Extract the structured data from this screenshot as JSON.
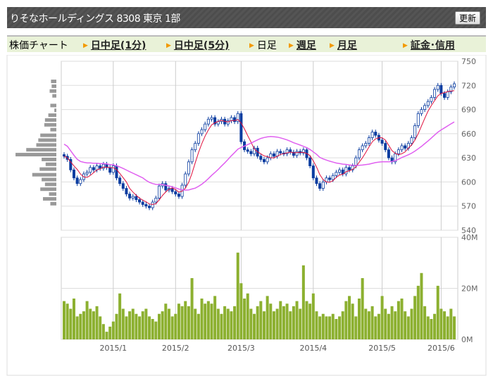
{
  "header": {
    "title": "りそなホールディングス  8308  東京 1部",
    "refresh_label": "更新"
  },
  "tabs": {
    "label": "株価チャート",
    "items": [
      {
        "label": "日中足(1分)",
        "link": true
      },
      {
        "label": "日中足(5分)",
        "link": true
      },
      {
        "label": "日足",
        "link": false
      },
      {
        "label": "週足",
        "link": true
      },
      {
        "label": "月足",
        "link": true
      },
      {
        "label": "証金･信用",
        "link": true
      }
    ]
  },
  "colors": {
    "up": "#0a3ca0",
    "ma_short": "#e0103c",
    "ma_long": "#e060f0",
    "volume": "#8cb030",
    "profile": "#999999"
  },
  "chart_data": {
    "type": "candlestick",
    "price_axis": {
      "ticks": [
        "750",
        "720",
        "690",
        "660",
        "630",
        "600",
        "570",
        "540"
      ],
      "range": [
        540,
        750
      ]
    },
    "volume_axis": {
      "ticks": [
        "40M",
        "20M",
        "0M"
      ],
      "range": [
        0,
        40
      ]
    },
    "x_ticks": [
      {
        "label": "2015/1",
        "day": 15
      },
      {
        "label": "2015/2",
        "day": 34
      },
      {
        "label": "2015/3",
        "day": 54
      },
      {
        "label": "2015/4",
        "day": 76
      },
      {
        "label": "2015/5",
        "day": 97
      },
      {
        "label": "2015/6",
        "day": 115
      }
    ],
    "close": [
      632,
      628,
      615,
      605,
      598,
      603,
      610,
      612,
      618,
      615,
      620,
      617,
      622,
      618,
      612,
      620,
      605,
      598,
      592,
      585,
      580,
      582,
      578,
      575,
      572,
      570,
      568,
      575,
      580,
      595,
      598,
      590,
      592,
      588,
      585,
      582,
      596,
      610,
      625,
      640,
      648,
      660,
      665,
      672,
      678,
      680,
      672,
      675,
      678,
      672,
      676,
      680,
      675,
      685,
      650,
      640,
      638,
      635,
      642,
      632,
      628,
      625,
      630,
      635,
      632,
      638,
      636,
      635,
      640,
      637,
      633,
      638,
      636,
      640,
      630,
      620,
      605,
      598,
      592,
      600,
      605,
      603,
      608,
      612,
      615,
      610,
      618,
      615,
      620,
      630,
      640,
      645,
      648,
      655,
      662,
      658,
      652,
      648,
      640,
      630,
      625,
      635,
      640,
      645,
      642,
      648,
      655,
      670,
      685,
      690,
      695,
      700,
      705,
      715,
      720,
      710,
      705,
      712,
      718,
      722
    ],
    "volume_m": [
      15,
      14,
      12,
      16,
      9,
      10,
      11,
      15,
      12,
      11,
      13,
      9,
      6,
      3,
      5,
      7,
      10,
      18,
      12,
      9,
      11,
      12,
      10,
      9,
      11,
      12,
      9,
      8,
      7,
      10,
      11,
      14,
      12,
      9,
      10,
      14,
      13,
      15,
      13,
      24,
      12,
      10,
      16,
      14,
      15,
      14,
      17,
      12,
      10,
      13,
      12,
      11,
      13,
      34,
      22,
      16,
      18,
      12,
      10,
      13,
      15,
      11,
      17,
      14,
      11,
      12,
      15,
      13,
      14,
      11,
      13,
      15,
      12,
      29,
      15,
      14,
      18,
      11,
      9,
      10,
      9,
      9,
      10,
      8,
      9,
      11,
      15,
      17,
      14,
      9,
      16,
      24,
      12,
      11,
      13,
      9,
      10,
      17,
      12,
      10,
      13,
      11,
      15,
      16,
      11,
      9,
      12,
      17,
      21,
      26,
      13,
      9,
      8,
      10,
      21,
      12,
      11,
      9,
      12,
      9
    ],
    "ma_periods": [
      5,
      25
    ],
    "price_profile": {
      "levels": [
        725,
        719,
        713,
        707,
        701,
        695,
        689,
        683,
        677,
        671,
        665,
        658,
        652,
        646,
        640,
        634,
        628,
        622,
        616,
        609,
        603,
        597,
        591,
        585,
        579,
        573
      ],
      "values": [
        8,
        7,
        10,
        6,
        0,
        9,
        3,
        12,
        17,
        18,
        9,
        24,
        27,
        30,
        45,
        61,
        22,
        16,
        25,
        36,
        22,
        17,
        24,
        11,
        20,
        9
      ]
    }
  }
}
